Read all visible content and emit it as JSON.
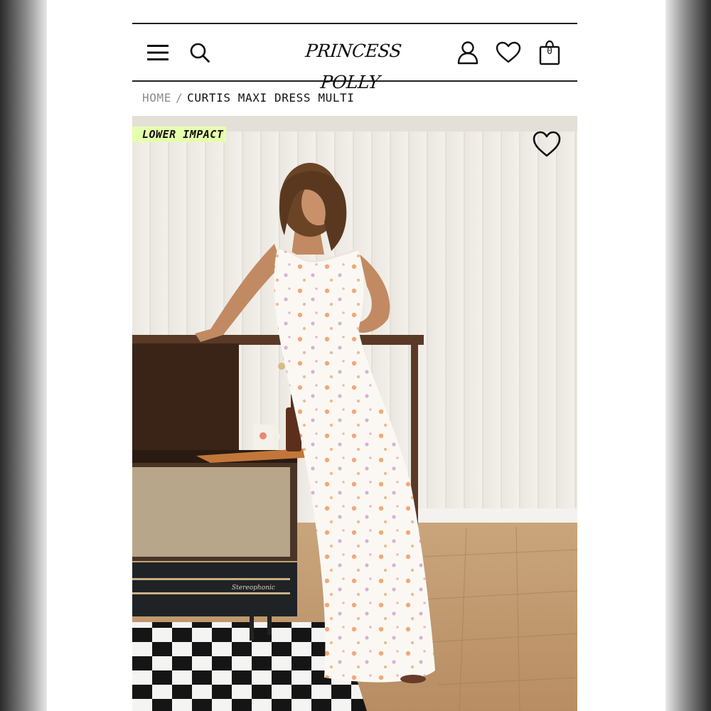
{
  "header": {
    "logo": "PRINCESS POLLY",
    "menu_icon": "hamburger-menu-icon",
    "search_icon": "search-icon",
    "account_icon": "user-icon",
    "wishlist_icon": "heart-icon",
    "cart_icon": "shopping-bag-icon",
    "cart_count": "0"
  },
  "breadcrumb": {
    "home": "HOME",
    "separator": "/",
    "current": "CURTIS MAXI DRESS MULTI"
  },
  "product_image": {
    "badge": "LOWER IMPACT",
    "wishlist_icon": "heart-icon",
    "record_player_brand": "Stereophonic"
  },
  "colors": {
    "badge_bg": "#e6ffad",
    "text": "#111111",
    "muted": "#8c8c8c"
  }
}
